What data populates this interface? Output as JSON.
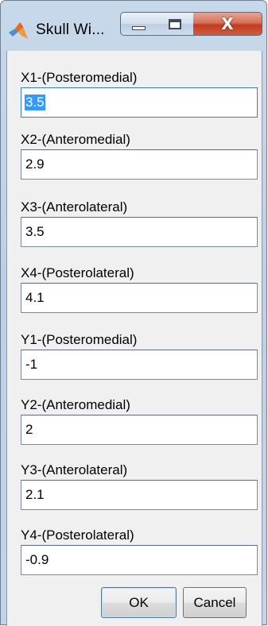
{
  "window": {
    "title": "Skull Wi...",
    "controls": {
      "minimize": "minimize-icon",
      "maximize": "maximize-icon",
      "close_label": "X"
    },
    "app_icon": "matlab-icon"
  },
  "fields": [
    {
      "label": "X1-(Posteromedial)",
      "value": "3.5",
      "selected": true
    },
    {
      "label": "X2-(Anteromedial)",
      "value": "2.9",
      "selected": false
    },
    {
      "label": "X3-(Anterolateral)",
      "value": "3.5",
      "selected": false
    },
    {
      "label": "X4-(Posterolateral)",
      "value": "4.1",
      "selected": false
    },
    {
      "label": "Y1-(Posteromedial)",
      "value": "-1",
      "selected": false
    },
    {
      "label": "Y2-(Anteromedial)",
      "value": "2",
      "selected": false
    },
    {
      "label": "Y3-(Anterolateral)",
      "value": "2.1",
      "selected": false
    },
    {
      "label": "Y4-(Posterolateral)",
      "value": "-0.9",
      "selected": false
    }
  ],
  "buttons": {
    "ok_label": "OK",
    "cancel_label": "Cancel"
  },
  "colors": {
    "selection": "#3399ff",
    "client_background": "#f0f0f0",
    "close_button": "#c23c1f"
  }
}
